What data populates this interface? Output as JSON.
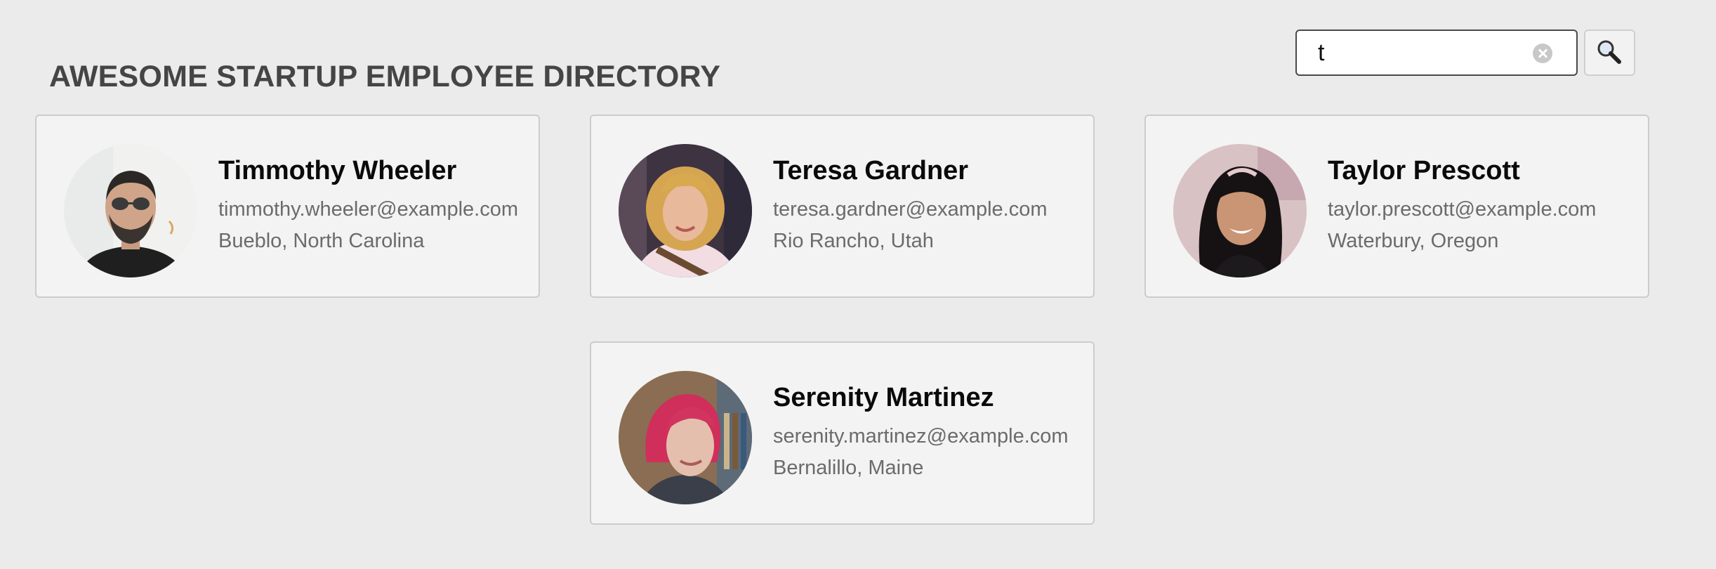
{
  "header": {
    "title": "AWESOME STARTUP EMPLOYEE DIRECTORY"
  },
  "search": {
    "value": "t",
    "placeholder": "",
    "clear_icon": "clear-icon",
    "submit_icon": "magnifying-glass-icon"
  },
  "employees": [
    {
      "name": "Timmothy Wheeler",
      "email": "timmothy.wheeler@example.com",
      "location": "Bueblo, North Carolina"
    },
    {
      "name": "Teresa Gardner",
      "email": "teresa.gardner@example.com",
      "location": "Rio Rancho, Utah"
    },
    {
      "name": "Taylor Prescott",
      "email": "taylor.prescott@example.com",
      "location": "Waterbury, Oregon"
    },
    {
      "name": "Serenity Martinez",
      "email": "serenity.martinez@example.com",
      "location": "Bernalillo, Maine"
    }
  ],
  "colors": {
    "background": "#ebebeb",
    "card_background": "#f3f3f3",
    "card_border": "#cccccc",
    "title_text": "#454545",
    "name_text": "#0a0a0a",
    "detail_text": "#6b6b6b"
  }
}
